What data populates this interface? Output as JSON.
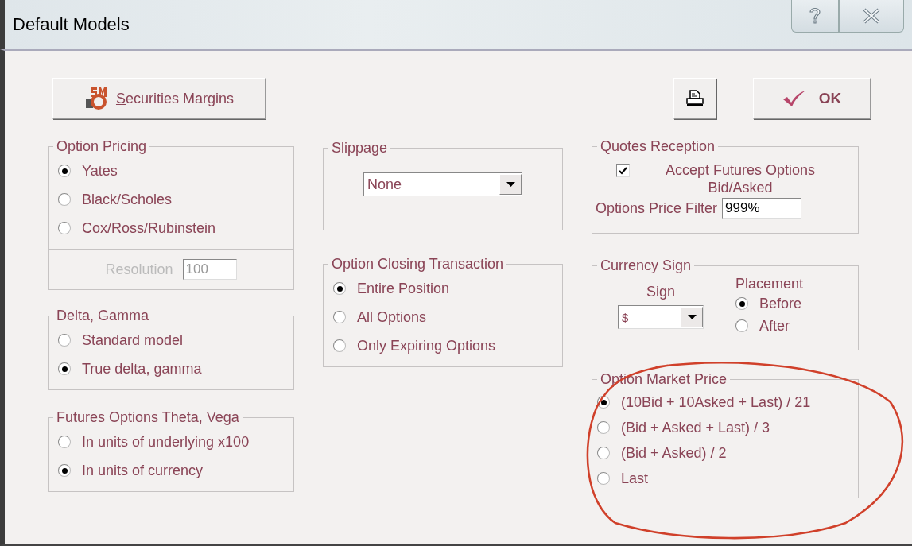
{
  "window": {
    "title": "Default Models"
  },
  "margins_button": {
    "label": "Securities Margins"
  },
  "ok_button": {
    "label": "OK"
  },
  "option_pricing": {
    "title": "Option Pricing",
    "options": [
      {
        "label": "Yates",
        "selected": true
      },
      {
        "label": "Black/Scholes",
        "selected": false
      },
      {
        "label": "Cox/Ross/Rubinstein",
        "selected": false
      }
    ],
    "resolution": {
      "label": "Resolution",
      "value": "100",
      "disabled": true
    }
  },
  "delta_gamma": {
    "title": "Delta, Gamma",
    "options": [
      {
        "label": "Standard model",
        "selected": false
      },
      {
        "label": "True delta, gamma",
        "selected": true
      }
    ]
  },
  "theta_vega": {
    "title": "Futures Options Theta, Vega",
    "options": [
      {
        "label": "In units of underlying x100",
        "selected": false
      },
      {
        "label": "In units of currency",
        "selected": true
      }
    ]
  },
  "slippage": {
    "title": "Slippage",
    "value": "None"
  },
  "option_closing": {
    "title": "Option Closing Transaction",
    "options": [
      {
        "label": "Entire Position",
        "selected": true
      },
      {
        "label": "All Options",
        "selected": false
      },
      {
        "label": "Only Expiring Options",
        "selected": false
      }
    ]
  },
  "quotes_reception": {
    "title": "Quotes Reception",
    "accept": {
      "label": "Accept Futures Options Bid/Asked",
      "checked": true
    },
    "filter": {
      "label": "Options Price Filter",
      "value": "999%"
    }
  },
  "currency_sign": {
    "title": "Currency Sign",
    "sign_label": "Sign",
    "sign_value": "$",
    "placement_label": "Placement",
    "placement": [
      {
        "label": "Before",
        "selected": true
      },
      {
        "label": "After",
        "selected": false
      }
    ]
  },
  "option_market_price": {
    "title": "Option Market Price",
    "options": [
      {
        "label": "(10Bid + 10Asked + Last) / 21",
        "selected": true
      },
      {
        "label": "(Bid + Asked + Last) / 3",
        "selected": false
      },
      {
        "label": "(Bid + Asked) / 2",
        "selected": false
      },
      {
        "label": "Last",
        "selected": false
      }
    ]
  }
}
